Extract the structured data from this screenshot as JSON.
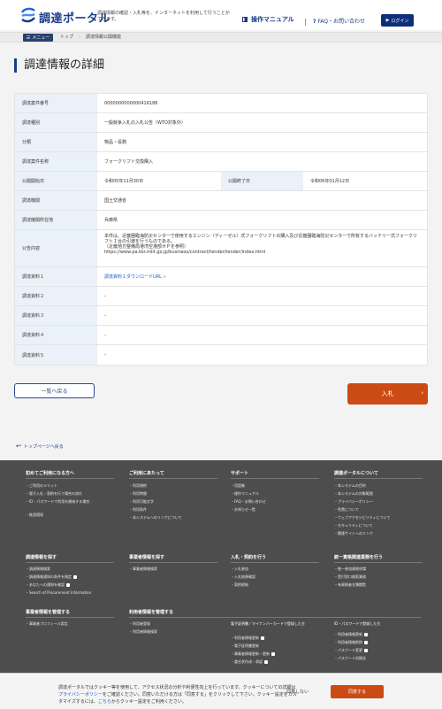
{
  "header": {
    "logo_text": "調達ポータル",
    "tagline": "調達情報の確認・入札等を、インターネットを利用して行うことができます。",
    "manual_label": "操作マニュアル",
    "faq_label": "FAQ・お問い合わせ",
    "login_label": "ログイン"
  },
  "breadcrumb": {
    "menu_label": "メニュー",
    "items": [
      "トップ",
      "調達情報公開機能"
    ]
  },
  "page_title": "調達情報の詳細",
  "details": {
    "rows": [
      {
        "label": "調達案件番号",
        "value": "0000000000000416186"
      },
      {
        "label": "調達種別",
        "value": "一般競争入札の入札公告（WTO対象外）"
      },
      {
        "label": "分類",
        "value": "物品・役務"
      },
      {
        "label": "調達案件名称",
        "value": "フォークリフト交換購入"
      }
    ],
    "period": {
      "start_label": "公開開始日",
      "start_value": "令和05年11月30日",
      "end_label": "公開終了日",
      "end_value": "令和06年01月12日"
    },
    "org": {
      "label": "調達機関",
      "value": "国土交通省"
    },
    "location": {
      "label": "調達機関所在地",
      "value": "兵庫県"
    },
    "notice": {
      "label": "公告内容",
      "line1": "本件は、近畿圏臨海防災センターで使用するエンジン（ディーゼル）式フォークリフトの購入及び近畿圏臨海防災センターで所有するバッテリー式フォークリフト１台の引渡を行うものである。",
      "line2": "（近畿地方整備局港湾空港部ＨＰを参照）",
      "line3": "https://www.pa.kkr.mlit.go.jp/business/contract/tender/tender/index.html"
    },
    "docs": [
      {
        "label": "調達資料１",
        "value": "調達資料１ダウンロードURL"
      },
      {
        "label": "調達資料２",
        "value": "-"
      },
      {
        "label": "調達資料３",
        "value": "-"
      },
      {
        "label": "調達資料４",
        "value": "-"
      },
      {
        "label": "調達資料５",
        "value": "-"
      }
    ]
  },
  "buttons": {
    "back": "一覧へ戻る",
    "bid": "入札"
  },
  "to_top": "トップページへ戻る",
  "footer": {
    "col1": {
      "title": "初めてご利用になる方へ",
      "items": [
        "ご利用のメリット",
        "電子入札・契約を行う場合の流れ",
        "ID・パスワードで利用を開始する場合",
        "推奨環境"
      ]
    },
    "col2": {
      "title": "ご利用にあたって",
      "items": [
        "利用規約",
        "利用時間",
        "利用可能文字",
        "利用条件",
        "本システムへのリンクについて"
      ]
    },
    "col3": {
      "title": "サポート",
      "items": [
        "用語集",
        "操作マニュアル",
        "FAQ・お問い合わせ",
        "お知らせ一覧"
      ]
    },
    "col4": {
      "title": "調達ポータルについて",
      "items": [
        "本システムの目的",
        "本システムの対象範囲",
        "プライバシーポリシー",
        "免責について",
        "ウェブアクセシビリティについて",
        "セキュリティについて",
        "関連サイトへのリンク"
      ]
    },
    "col5": {
      "title": "調達情報を探す",
      "items": [
        "調達情報検索",
        "調達情報通知の条件を指定",
        "あなたへの通知を確認",
        "Search of Procurement Information"
      ]
    },
    "col6": {
      "title": "事業者情報を探す",
      "items": [
        "事業者情報検索"
      ]
    },
    "col7": {
      "title": "入札・契約を行う",
      "items": [
        "入札参加",
        "入札結果確認",
        "契約締結"
      ]
    },
    "col8": {
      "title": "統一資格関連業務を行う",
      "items": [
        "統一参加資格申請",
        "受付窓口検索業務",
        "有資格者名簿閲覧"
      ]
    },
    "col9": {
      "title": "事業者情報を管理する",
      "items": [
        "事業者プロフィール設定"
      ]
    },
    "col10": {
      "title": "利用者情報を管理する",
      "items": [
        "利用者登録",
        "利用者情報検索"
      ]
    },
    "col11": {
      "title": "電子証明書／マイナンバーカードで登録した方",
      "items": [
        "利用者情報更新",
        "電子証明書更新",
        "事業者情報更新・更新",
        "委任状作成・承認"
      ]
    },
    "col12": {
      "title": "ID・パスワードで登録した方",
      "items": [
        "利用者情報更新",
        "利用者情報削除",
        "パスワード変更",
        "パスワード初期化"
      ]
    }
  },
  "cookie": {
    "text_a": "調達ポータルではクッキー等を使用して、アクセス状況の分析や利便性向上を行っています。クッキーについての詳細は",
    "policy_link": "プライバシーポリシー",
    "text_b": "をご確認ください。同意いただける方は「同意する」をクリックして下さい。クッキー設定をカスタマイズするには、",
    "here_link": "こちら",
    "text_c": "からクッキー設定をご利用ください。",
    "reject": "同意しない",
    "accept": "同意する"
  }
}
